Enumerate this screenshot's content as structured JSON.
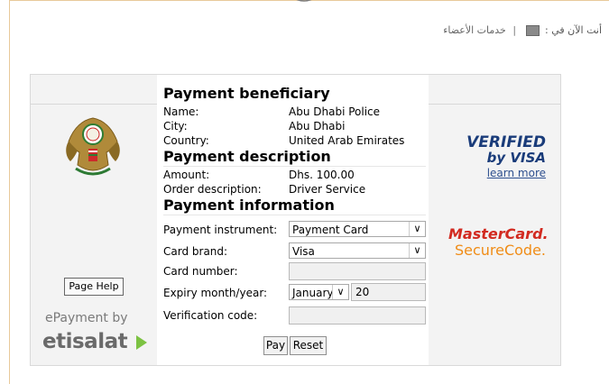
{
  "breadcrumb": {
    "prefix": "أنت الآن في :",
    "separator": "|",
    "link": "خدمات الأعضاء"
  },
  "payment": {
    "beneficiary_heading": "Payment beneficiary",
    "name_label": "Name:",
    "name_value": "Abu Dhabi Police",
    "city_label": "City:",
    "city_value": "Abu Dhabi",
    "country_label": "Country:",
    "country_value": "United Arab Emirates",
    "description_heading": "Payment description",
    "amount_label": "Amount:",
    "amount_value": "Dhs. 100.00",
    "order_label": "Order description:",
    "order_value": "Driver Service",
    "information_heading": "Payment information",
    "instrument_label": "Payment instrument:",
    "instrument_value": "Payment Card",
    "brand_label": "Card brand:",
    "brand_value": "Visa",
    "card_number_label": "Card number:",
    "card_number_value": "",
    "expiry_label": "Expiry month/year:",
    "expiry_month": "January",
    "expiry_year": "20",
    "verification_label": "Verification code:",
    "verification_value": "",
    "pay_button": "Pay",
    "reset_button": "Reset"
  },
  "left": {
    "page_help": "Page Help",
    "epayment_by": "ePayment by",
    "etisalat": "etisalat"
  },
  "right": {
    "verified": "VERIFIED",
    "by_visa": "by VISA",
    "learn_more": "learn more",
    "mastercard": "MasterCard.",
    "securecode": "SecureCode."
  },
  "colors": {
    "visa_blue": "#1a3c7a",
    "mc_red": "#d22a20",
    "mc_orange": "#f08c17",
    "etisalat_green": "#7cc242"
  },
  "icons": {
    "emblem": "uae-eagle-emblem-icon",
    "breadcrumb": "folder-icon",
    "dropdown": "chevron-down-icon"
  }
}
